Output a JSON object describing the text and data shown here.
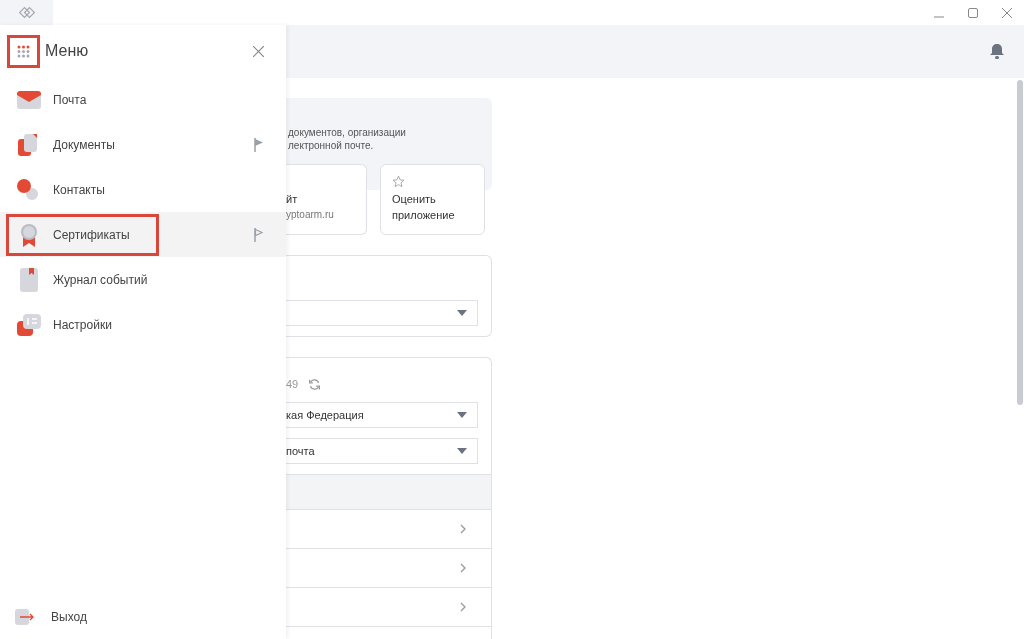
{
  "menu": {
    "title": "Меню",
    "highlighted": true,
    "items": [
      {
        "label": "Почта",
        "selected": false,
        "highlighted": false
      },
      {
        "label": "Документы",
        "selected": false,
        "highlighted": false,
        "pinned": true
      },
      {
        "label": "Контакты",
        "selected": false,
        "highlighted": false
      },
      {
        "label": "Сертификаты",
        "selected": true,
        "highlighted": true,
        "pinned": false
      },
      {
        "label": "Журнал событий",
        "selected": false,
        "highlighted": false
      },
      {
        "label": "Настройки",
        "selected": false,
        "highlighted": false
      }
    ],
    "logout": "Выход"
  },
  "info_card": {
    "text_lines": [
      "документов, организации",
      "лектронной почте."
    ]
  },
  "links": [
    {
      "title": "йт",
      "subtitle": "yptoarm.ru"
    },
    {
      "title": "Оценить приложение"
    }
  ],
  "region_card": {
    "code": "49",
    "selects": [
      "кая Федерация",
      "почта"
    ]
  }
}
